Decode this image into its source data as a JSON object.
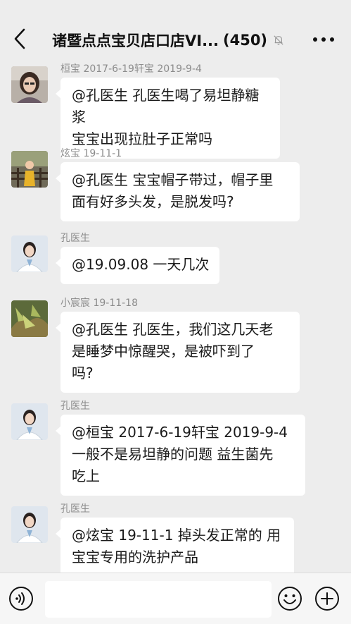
{
  "header": {
    "back_icon": "chevron-left-icon",
    "title": "诸暨点点宝贝店口店VI...",
    "member_count": "(450)",
    "mute_icon": "bell-off-icon",
    "more_icon": "more-horizontal-icon"
  },
  "messages": [
    {
      "sender": "桓宝 2017-6-19轩宝 2019-9-4",
      "lines": [
        "@孔医生 孔医生喝了易坦静糖浆",
        "宝宝出现拉肚子正常吗"
      ]
    },
    {
      "sender": "炫宝 19-11-1",
      "lines": [
        "@孔医生 宝宝帽子带过，帽子里",
        "面有好多头发，是脱发吗?"
      ]
    },
    {
      "sender": "孔医生",
      "lines": [
        "@19.09.08 一天几次"
      ]
    },
    {
      "sender": "小宸宸 19-11-18",
      "lines": [
        "@孔医生 孔医生，我们这几天老",
        "是睡梦中惊醒哭，是被吓到了",
        "吗?"
      ]
    },
    {
      "sender": "孔医生",
      "lines": [
        "@桓宝 2017-6-19轩宝 2019-9-4",
        "一般不是易坦静的问题 益生菌先",
        "吃上"
      ]
    },
    {
      "sender": "孔医生",
      "lines": [
        "@炫宝 19-11-1 掉头发正常的 用",
        "宝宝专用的洗护产品"
      ]
    }
  ],
  "input_bar": {
    "voice_icon": "voice-icon",
    "input_value": "",
    "emoji_icon": "emoji-icon",
    "plus_icon": "plus-icon"
  }
}
